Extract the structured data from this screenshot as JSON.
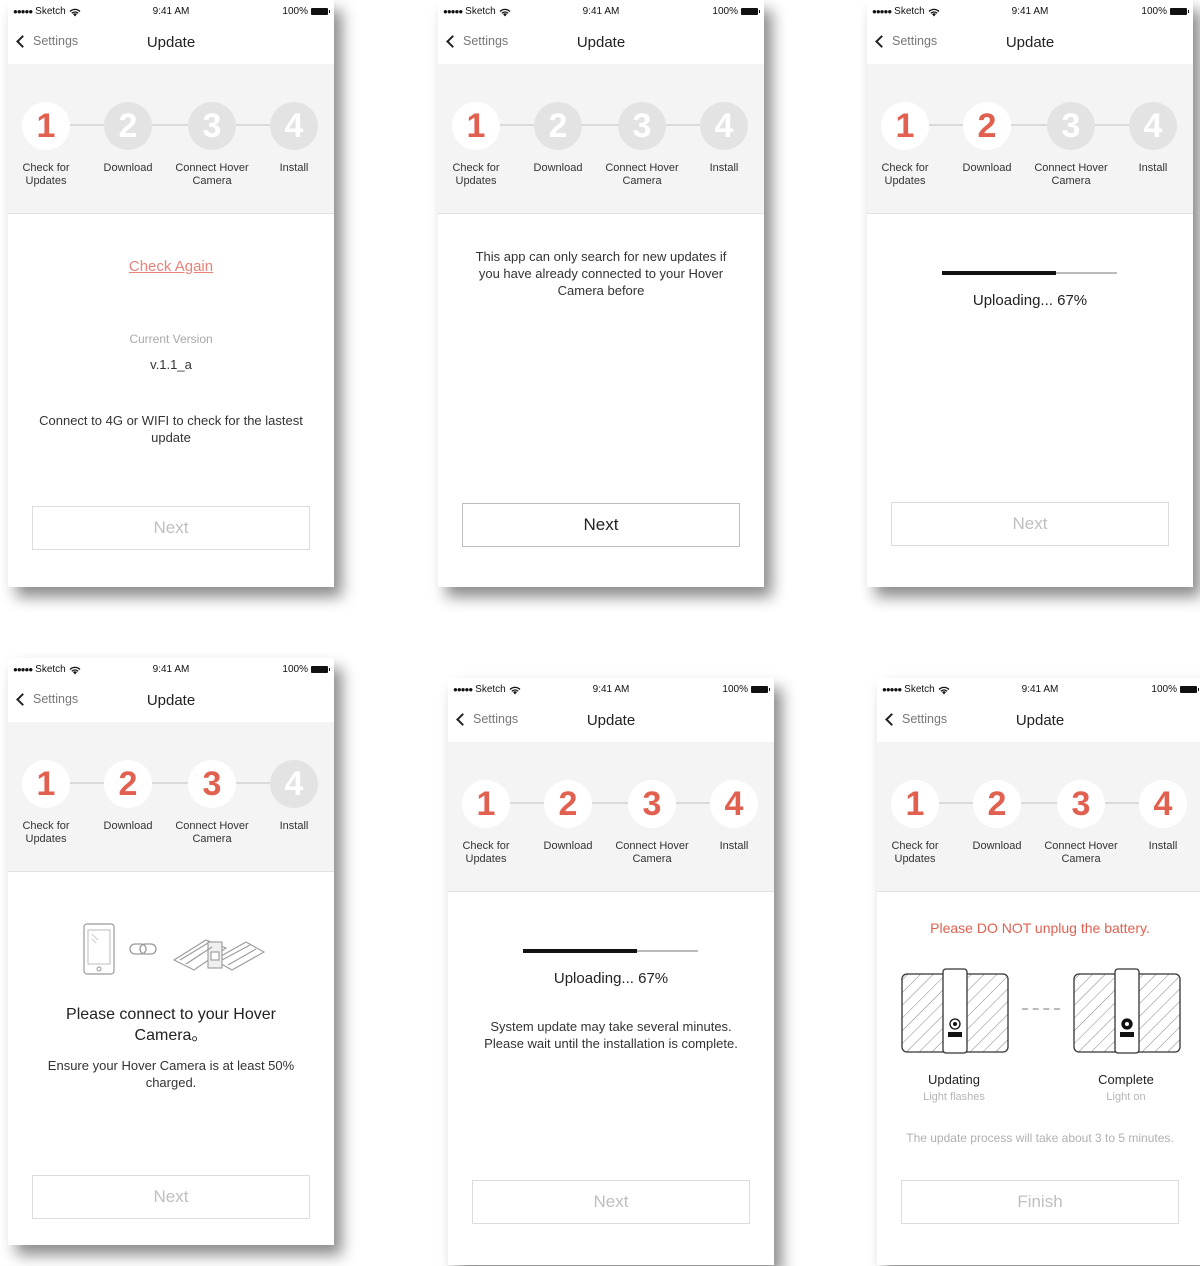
{
  "status_bar": {
    "carrier": "Sketch",
    "time": "9:41 AM",
    "battery": "100%"
  },
  "nav": {
    "back_label": "Settings",
    "title": "Update"
  },
  "steps": [
    {
      "number": "1",
      "label": "Check for Updates"
    },
    {
      "number": "2",
      "label": "Download"
    },
    {
      "number": "3",
      "label": "Connect Hover Camera"
    },
    {
      "number": "4",
      "label": "Install"
    }
  ],
  "colors": {
    "accent": "#e26050",
    "step_inactive": "#e3e3e3",
    "panel_bg": "#f4f4f4",
    "link": "#e8837a"
  },
  "screen1": {
    "active_steps": 1,
    "check_again": "Check Again",
    "current_version_label": "Current Version",
    "current_version": "v.1.1_a",
    "message": "Connect to 4G or WIFI to check for the lastest update",
    "button": "Next",
    "button_enabled": false
  },
  "screen2": {
    "active_steps": 1,
    "message": "This app can only search for new updates if you have already connected to your Hover Camera before",
    "button": "Next",
    "button_enabled": true
  },
  "screen3": {
    "active_steps": 2,
    "progress": 0.67,
    "uploading": "Uploading... 67%",
    "button": "Next",
    "button_enabled": false
  },
  "screen4": {
    "active_steps": 3,
    "illustration": [
      "phone-icon",
      "link-icon",
      "hover-camera-icon"
    ],
    "title": "Please connect to your Hover Camera。",
    "message": "Ensure your Hover Camera is at least 50% charged.",
    "button": "Next",
    "button_enabled": false
  },
  "screen5": {
    "active_steps": 4,
    "progress": 0.67,
    "uploading": "Uploading... 67%",
    "message": "System update may take several minutes. Please wait until the installation is complete.",
    "button": "Next",
    "button_enabled": false
  },
  "screen6": {
    "active_steps": 4,
    "warning": "Please DO NOT unplug the battery.",
    "device_logo": "HOVER",
    "updating_title": "Updating",
    "updating_sub": "Light flashes",
    "complete_title": "Complete",
    "complete_sub": "Light on",
    "note": "The update process will take about 3 to 5 minutes.",
    "button": "Finish",
    "button_enabled": false
  }
}
